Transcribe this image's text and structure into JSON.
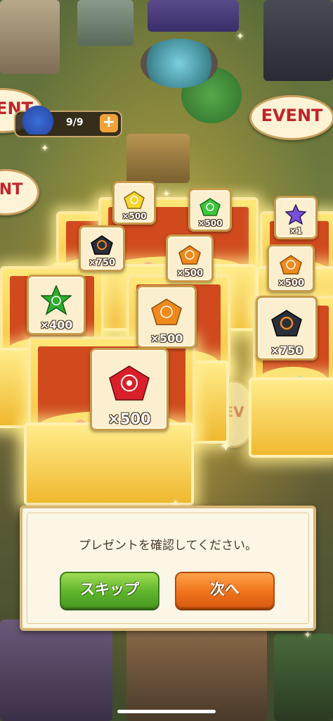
{
  "hud": {
    "stamina": "9/9",
    "add_label": "+"
  },
  "event_signs": [
    "EVENT",
    "EVENT",
    "ENT",
    "EV"
  ],
  "rewards": [
    {
      "icon": "yellow-gem-icon",
      "color": "#f5d630",
      "quantity": "×500"
    },
    {
      "icon": "green-gem-icon",
      "color": "#3cc63c",
      "quantity": "×500"
    },
    {
      "icon": "purple-star-icon",
      "color": "#7a4fd8",
      "quantity": "×1"
    },
    {
      "icon": "black-gem-icon",
      "color": "#2a2f3a",
      "quantity": "×750"
    },
    {
      "icon": "orange-gem-icon",
      "color": "#f08a1c",
      "quantity": "×500"
    },
    {
      "icon": "orange-gem-icon",
      "color": "#f08a1c",
      "quantity": "×500"
    },
    {
      "icon": "green-star-icon",
      "color": "#2fae2f",
      "quantity": "×400"
    },
    {
      "icon": "orange-gem-icon",
      "color": "#f08a1c",
      "quantity": "×500"
    },
    {
      "icon": "black-gem-icon",
      "color": "#2a2f3a",
      "quantity": "×750"
    },
    {
      "icon": "red-gem-icon",
      "color": "#d8202a",
      "quantity": "×500"
    }
  ],
  "dialog": {
    "message": "プレゼントを確認してください。",
    "skip_label": "スキップ",
    "next_label": "次へ"
  },
  "colors": {
    "skip_button": "#5fb52c",
    "next_button": "#f0731c",
    "dialog_bg": "#fcf6e6"
  }
}
